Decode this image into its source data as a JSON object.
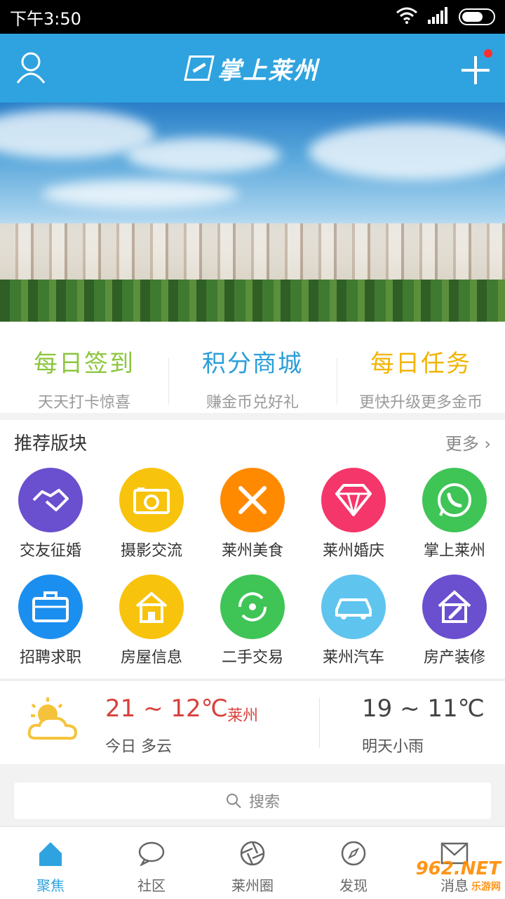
{
  "status_bar": {
    "time": "下午3:50"
  },
  "app_bar": {
    "title": "掌上莱州"
  },
  "quick_links": [
    {
      "title": "每日签到",
      "subtitle": "天天打卡惊喜",
      "color": "#8cc63e"
    },
    {
      "title": "积分商城",
      "subtitle": "赚金币兑好礼",
      "color": "#2b9ed8"
    },
    {
      "title": "每日任务",
      "subtitle": "更快升级更多金币",
      "color": "#f2b400"
    }
  ],
  "sections": {
    "title": "推荐版块",
    "more": "更多",
    "items": [
      {
        "label": "交友征婚",
        "icon": "handshake-icon",
        "color": "#6a4fcf"
      },
      {
        "label": "摄影交流",
        "icon": "camera-icon",
        "color": "#f7c30c"
      },
      {
        "label": "莱州美食",
        "icon": "fork-knife-icon",
        "color": "#ff8a00"
      },
      {
        "label": "莱州婚庆",
        "icon": "diamond-icon",
        "color": "#f5366a"
      },
      {
        "label": "掌上莱州",
        "icon": "phone-chat-icon",
        "color": "#3fc456"
      },
      {
        "label": "招聘求职",
        "icon": "briefcase-icon",
        "color": "#1b8ff0"
      },
      {
        "label": "房屋信息",
        "icon": "house-icon",
        "color": "#f7c30c"
      },
      {
        "label": "二手交易",
        "icon": "recycle-icon",
        "color": "#3fc456"
      },
      {
        "label": "莱州汽车",
        "icon": "car-icon",
        "color": "#5fc4ee"
      },
      {
        "label": "房产装修",
        "icon": "house-brush-icon",
        "color": "#6a4fcf"
      }
    ]
  },
  "weather": {
    "today_range": "21 ~ 12℃",
    "city": "莱州",
    "today_desc": "今日 多云",
    "tomorrow_range": "19 ~ 11℃",
    "tomorrow_desc": "明天小雨"
  },
  "search": {
    "placeholder": "搜索"
  },
  "tabs": [
    {
      "label": "聚焦",
      "icon": "home-icon",
      "active": true
    },
    {
      "label": "社区",
      "icon": "chat-bubble-icon",
      "active": false
    },
    {
      "label": "莱州圈",
      "icon": "aperture-icon",
      "active": false
    },
    {
      "label": "发现",
      "icon": "compass-icon",
      "active": false
    },
    {
      "label": "消息",
      "icon": "mail-icon",
      "active": false
    }
  ],
  "watermark": {
    "brand": "962.NET",
    "site": "乐游网"
  }
}
